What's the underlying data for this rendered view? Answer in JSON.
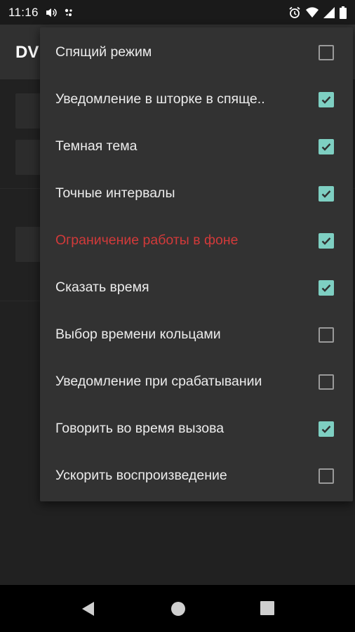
{
  "status_bar": {
    "time": "11:16",
    "icons": [
      "volume-icon",
      "assistant-dots-icon",
      "alarm-icon",
      "wifi-icon",
      "signal-icon",
      "battery-icon"
    ]
  },
  "app_bar": {
    "title": "DV"
  },
  "menu": {
    "items": [
      {
        "label": "Спящий режим",
        "checked": false
      },
      {
        "label": "Уведомление в шторке в спяще..",
        "checked": true
      },
      {
        "label": "Темная тема",
        "checked": true
      },
      {
        "label": "Точные интервалы",
        "checked": true
      },
      {
        "label": "Ограничение работы в фоне",
        "checked": true,
        "highlight": true
      },
      {
        "label": "Сказать время",
        "checked": true
      },
      {
        "label": "Выбор времени кольцами",
        "checked": false
      },
      {
        "label": "Уведомление при срабатывании",
        "checked": false
      },
      {
        "label": "Говорить во время вызова",
        "checked": true
      },
      {
        "label": "Ускорить воспроизведение",
        "checked": false
      }
    ]
  },
  "colors": {
    "accent": "#7ecfc2",
    "warning_text": "#d23a3a",
    "menu_bg": "#323232",
    "screen_bg": "#212121"
  },
  "nav_bar": {
    "icons": [
      "back-icon",
      "home-icon",
      "recents-icon"
    ]
  }
}
